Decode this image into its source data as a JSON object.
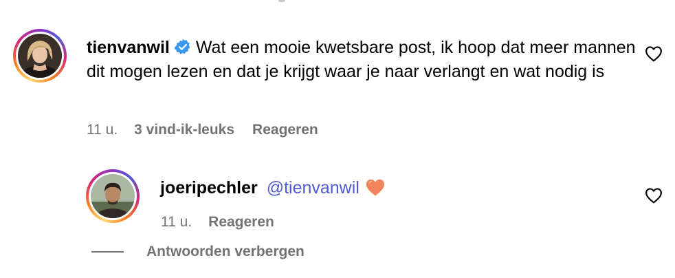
{
  "comments": [
    {
      "username": "tienvanwil",
      "verified": true,
      "text": "Wat een mooie kwetsbare post, ik hoop dat meer mannen dit mogen lezen en dat je krijgt waar je naar verlangt en wat nodig is",
      "time": "11 u.",
      "likes": "3 vind-ik-leuks",
      "reply_label": "Reageren",
      "avatar_icon": "profile-photo-woman"
    }
  ],
  "reply": {
    "username": "joeripechler",
    "mention": "@tienvanwil",
    "emoji": "orange-heart",
    "time": "11 u.",
    "reply_label": "Reageren",
    "avatar_icon": "profile-photo-man"
  },
  "hide_replies_label": "Antwoorden verbergen",
  "colors": {
    "meta": "#737373",
    "mention": "#4f5bd5",
    "verified": "#3897f0",
    "emoji_heart": "#f0845a"
  }
}
